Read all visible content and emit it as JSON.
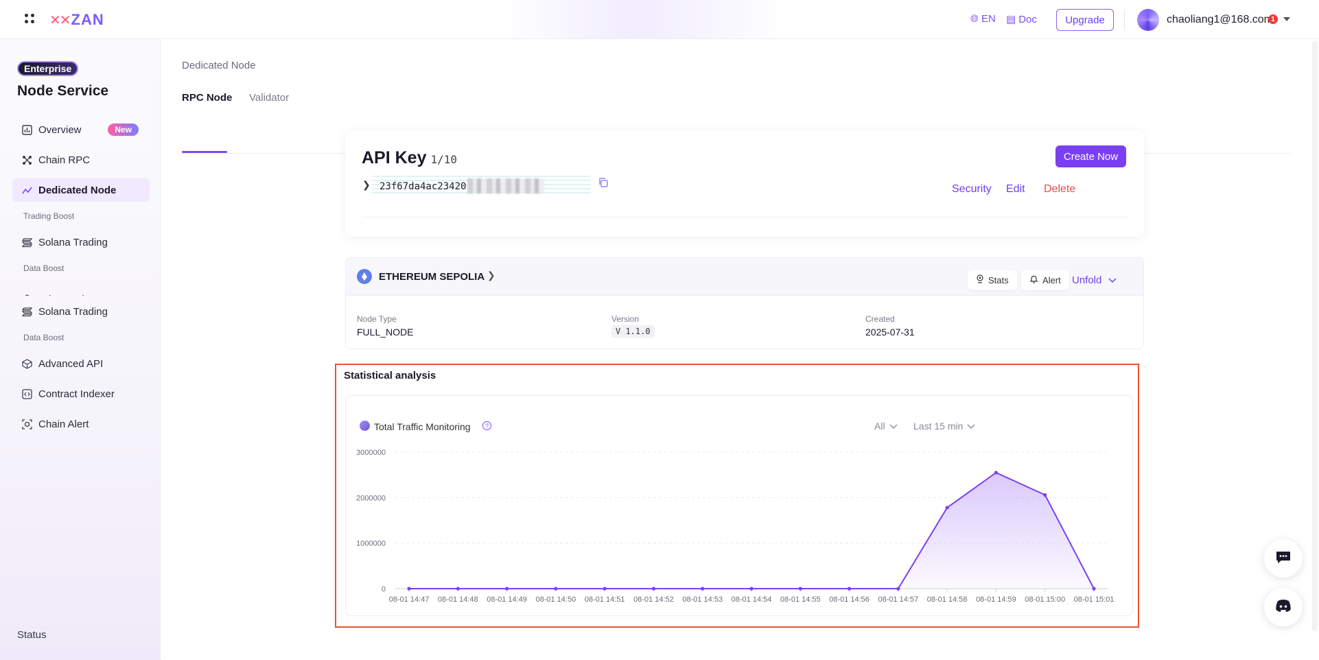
{
  "header": {
    "logo_text": "ZAN",
    "lang_label": "EN",
    "doc_label": "Doc",
    "upgrade_label": "Upgrade",
    "email": "chaoliang1@168.com",
    "notification_count": "1"
  },
  "sidebar": {
    "badge": "Enterprise",
    "title": "Node Service",
    "items": {
      "overview": "Overview",
      "overview_badge": "New",
      "chain_rpc": "Chain RPC",
      "dedicated_node": "Dedicated Node",
      "group_trading": "Trading Boost",
      "solana_trading": "Solana Trading",
      "group_data": "Data Boost",
      "advanced_api": "Advanced API",
      "contract_indexer": "Contract Indexer",
      "chain_alert": "Chain Alert"
    },
    "status_label": "Status"
  },
  "main": {
    "breadcrumb": "Dedicated Node",
    "tabs": [
      "RPC Node",
      "Validator"
    ],
    "api_key": {
      "title": "API Key",
      "count": "1/10",
      "create_label": "Create Now",
      "key_prefix": "23f67da4ac23420",
      "actions": {
        "security": "Security",
        "edit": "Edit",
        "delete": "Delete"
      }
    },
    "node": {
      "network": "ETHEREUM SEPOLIA",
      "stats_label": "Stats",
      "alert_label": "Alert",
      "unfold_label": "Unfold",
      "fields": {
        "type_label": "Node Type",
        "type_value": "FULL_NODE",
        "version_label": "Version",
        "version_value": "V 1.1.0",
        "created_label": "Created",
        "created_value": "2025-07-31"
      }
    },
    "stats": {
      "section_title": "Statistical analysis",
      "chart_title": "Total Traffic Monitoring",
      "filter_all": "All",
      "filter_range": "Last 15 min"
    }
  },
  "chart_data": {
    "type": "area",
    "title": "Total Traffic Monitoring",
    "xlabel": "",
    "ylabel": "",
    "x": [
      "08-01 14:47",
      "08-01 14:48",
      "08-01 14:49",
      "08-01 14:50",
      "08-01 14:51",
      "08-01 14:52",
      "08-01 14:53",
      "08-01 14:54",
      "08-01 14:55",
      "08-01 14:56",
      "08-01 14:57",
      "08-01 14:58",
      "08-01 14:59",
      "08-01 15:00",
      "08-01 15:01"
    ],
    "series": [
      {
        "values": [
          0,
          0,
          0,
          0,
          0,
          0,
          0,
          0,
          0,
          0,
          0,
          1780000,
          2550000,
          2060000,
          0
        ]
      }
    ],
    "ylim": [
      0,
      3000000
    ],
    "yticks": [
      "0",
      "1000000",
      "2000000",
      "3000000"
    ],
    "grid": true,
    "color": "#7b3ff2"
  }
}
